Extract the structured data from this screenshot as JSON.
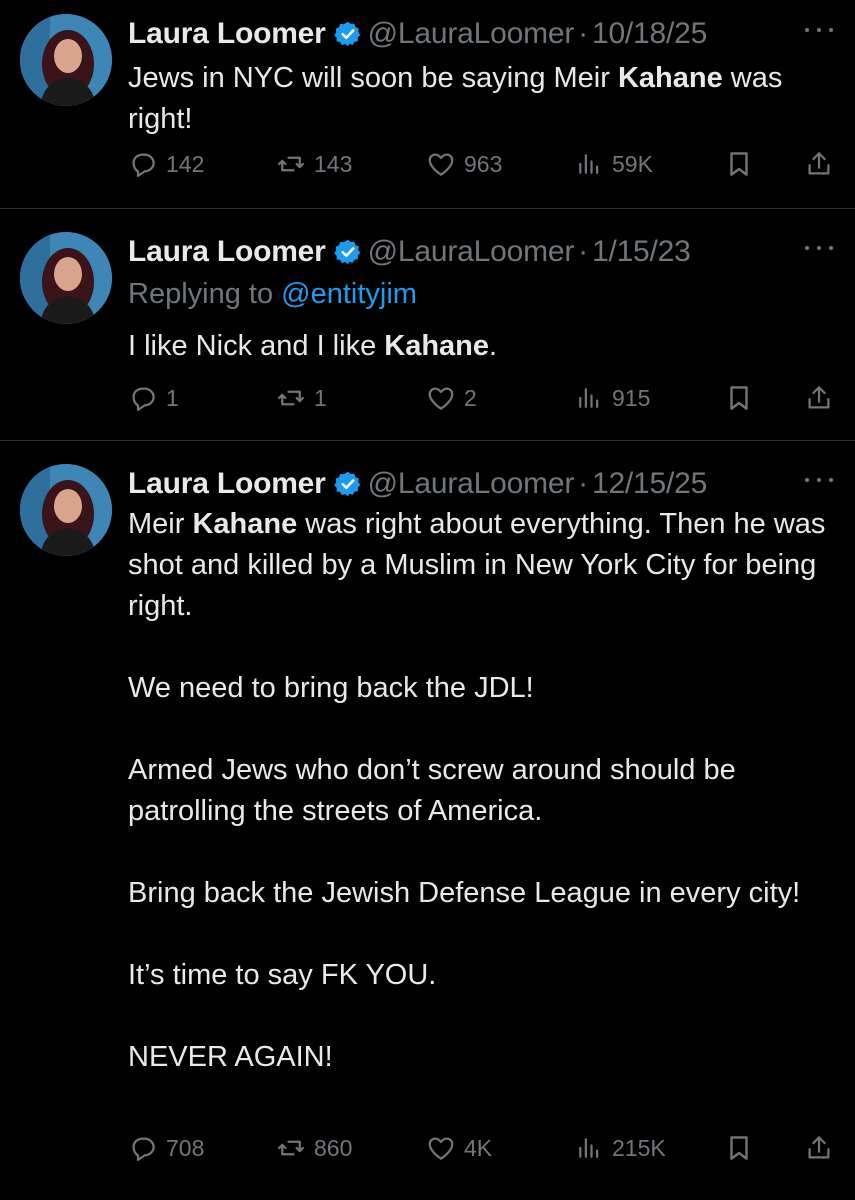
{
  "tweets": [
    {
      "author_name": "Laura Loomer",
      "handle": "@LauraLoomer",
      "separator": "·",
      "date": "10/18/25",
      "replying_label": "",
      "replying_to": "",
      "body": [
        {
          "parts": [
            {
              "text": "Jews in NYC will soon be saying Meir ",
              "bold": false
            },
            {
              "text": "Kahane",
              "bold": true
            },
            {
              "text": " was right!",
              "bold": false
            }
          ]
        }
      ],
      "stats": {
        "replies": "142",
        "reposts": "143",
        "likes": "963",
        "views": "59K"
      }
    },
    {
      "author_name": "Laura Loomer",
      "handle": "@LauraLoomer",
      "separator": "·",
      "date": "1/15/23",
      "replying_label": "Replying to ",
      "replying_to": "@entityjim",
      "body": [
        {
          "parts": [
            {
              "text": "I like Nick and I like ",
              "bold": false
            },
            {
              "text": "Kahane",
              "bold": true
            },
            {
              "text": ".",
              "bold": false
            }
          ]
        }
      ],
      "stats": {
        "replies": "1",
        "reposts": "1",
        "likes": "2",
        "views": "915"
      }
    },
    {
      "author_name": "Laura Loomer",
      "handle": "@LauraLoomer",
      "separator": "·",
      "date": "12/15/25",
      "replying_label": "",
      "replying_to": "",
      "body": [
        {
          "parts": [
            {
              "text": "Meir ",
              "bold": false
            },
            {
              "text": "Kahane",
              "bold": true
            },
            {
              "text": " was right about everything. Then he was shot and killed by a Muslim in New York City for being right.",
              "bold": false
            }
          ]
        },
        {
          "parts": [
            {
              "text": "We need to bring back the JDL!",
              "bold": false
            }
          ]
        },
        {
          "parts": [
            {
              "text": "Armed Jews who don’t screw around should be patrolling the streets of America.",
              "bold": false
            }
          ]
        },
        {
          "parts": [
            {
              "text": "Bring back the Jewish Defense League in every city!",
              "bold": false
            }
          ]
        },
        {
          "parts": [
            {
              "text": "It’s time to say FK YOU.",
              "bold": false
            }
          ]
        },
        {
          "parts": [
            {
              "text": "NEVER AGAIN!",
              "bold": false
            }
          ]
        }
      ],
      "stats": {
        "replies": "708",
        "reposts": "860",
        "likes": "4K",
        "views": "215K"
      }
    }
  ],
  "icons": {
    "verified": "verified-badge-icon",
    "more": "more-icon",
    "reply": "reply-icon",
    "repost": "repost-icon",
    "like": "like-icon",
    "views": "views-icon",
    "bookmark": "bookmark-icon",
    "share": "share-icon"
  },
  "colors": {
    "background": "#000000",
    "text": "#e7e9ea",
    "secondary": "#71767b",
    "accent": "#1d9bf0",
    "divider": "#2f3336"
  }
}
